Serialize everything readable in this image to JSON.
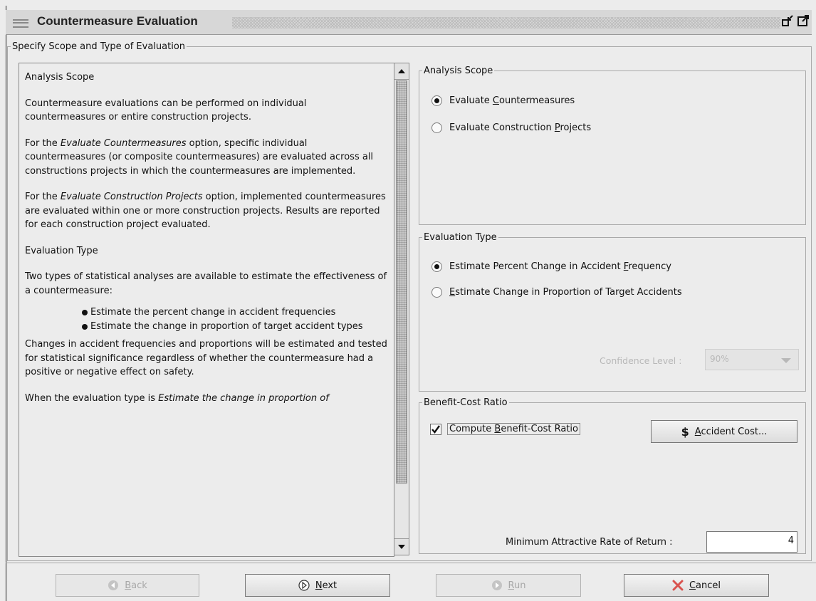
{
  "window": {
    "title": "Countermeasure Evaluation"
  },
  "outer_group": {
    "legend": "Specify Scope and Type of Evaluation"
  },
  "help": {
    "heading_scope": "Analysis Scope",
    "p1": "Countermeasure evaluations can be performed on individual countermeasures or entire construction projects.",
    "p2_pre": "For the ",
    "p2_em": "Evaluate Countermeasures",
    "p2_post": " option, specific individual countermeasures (or composite countermeasures) are evaluated across all constructions projects in which the countermeasures are implemented.",
    "p3_pre": "For the ",
    "p3_em": "Evaluate Construction Projects",
    "p3_post": " option, implemented countermeasures are evaluated within one or more construction projects. Results are reported for each construction project evaluated.",
    "heading_type": "Evaluation Type",
    "p4": "Two types of statistical analyses are available to estimate the effectiveness of a countermeasure:",
    "bullets": [
      "Estimate the percent change in accident frequencies",
      "Estimate the change in proportion of target accident types"
    ],
    "p5": "Changes in accident frequencies and proportions will be estimated and tested for statistical significance regardless of whether the countermeasure had a positive or negative effect on safety.",
    "p6_pre": "When the evaluation type is ",
    "p6_em": "Estimate the change in proportion of",
    "p6_post": ""
  },
  "scope": {
    "legend": "Analysis Scope",
    "opt1_a": "Evaluate ",
    "opt1_u": "C",
    "opt1_b": "ountermeasures",
    "opt2_a": "Evaluate Construction ",
    "opt2_u": "P",
    "opt2_b": "rojects",
    "selected": 1
  },
  "type": {
    "legend": "Evaluation Type",
    "opt1_a": "Estimate Percent Change in Accident ",
    "opt1_u": "F",
    "opt1_b": "requency",
    "opt2_u": "E",
    "opt2_b": "stimate Change in Proportion of Target Accidents",
    "selected": 1,
    "confidence_label": "Confidence Level :",
    "confidence_value": "90%"
  },
  "benefit": {
    "legend": "Benefit-Cost Ratio",
    "check_a": "Compute ",
    "check_u": "B",
    "check_b": "enefit-Cost Ratio",
    "checked": true,
    "acc_symbol": "$",
    "acc_u": "A",
    "acc_b": "ccident Cost...",
    "marr_label": "Minimum Attractive Rate of Return :",
    "marr_value": "4"
  },
  "buttons": {
    "back_u": "B",
    "back_b": "ack",
    "next_u": "N",
    "next_b": "ext",
    "run_u": "R",
    "run_b": "un",
    "cancel_u": "C",
    "cancel_b": "ancel"
  },
  "colors": {
    "background": "#ececec",
    "disabled_text": "#a8a8a8",
    "cancel_x": "#d9534f"
  }
}
